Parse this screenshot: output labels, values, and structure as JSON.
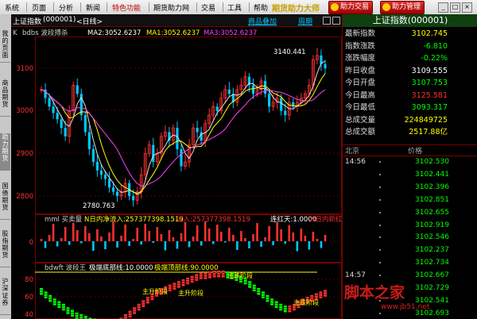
{
  "menu": {
    "items": [
      "系统",
      "页面",
      "分析",
      "新闻",
      "特色功能",
      "期货助力网",
      "交易",
      "工具",
      "帮助"
    ],
    "brand": "期货助力大师",
    "trade_btn": "助力交易",
    "manage_btn": "助力管理"
  },
  "left_tabs": [
    {
      "label": "我的页面",
      "active": false
    },
    {
      "label": "商品期货",
      "active": false
    },
    {
      "label": "助力期货",
      "active": true
    },
    {
      "label": "国债期货",
      "active": false
    },
    {
      "label": "股指期货",
      "active": false
    },
    {
      "label": "沪深证券",
      "active": false
    }
  ],
  "title_bar": {
    "name": "上证指数",
    "code": "(000001)",
    "period": "<日线>",
    "overlay_btn": "商品叠加",
    "cycle_btn": "周期"
  },
  "main_chart": {
    "indicator": "K",
    "name": "bdbs 波段搏杀",
    "ma2": "MA2:3052.6237",
    "ma1": "MA1:3052.6237",
    "ma3": "MA3:3052.6237",
    "y_ticks": [
      "3100",
      "3000",
      "2900",
      "2800"
    ],
    "high_label": "3140.441",
    "low_label": "2780.763"
  },
  "volume_chart": {
    "name": "mml 买卖量",
    "inflow_label": "N日内净流入:257377398.1519",
    "flow_label": "流入:257377398.1519",
    "streak_label": "连红天:1.0000",
    "red_label": "N日内新红天:",
    "y_ticks": [
      "0"
    ]
  },
  "osc_chart": {
    "name": "bdwft 波段王",
    "low_label": "极端底部线:10.0000",
    "high_label": "极端顶部线:90.0000",
    "y_ticks": [
      "80",
      "60",
      "40"
    ],
    "notes": [
      "主升阶段",
      "主升阶段",
      "主跌阶段",
      "主跌阶段"
    ]
  },
  "quote": {
    "title": "上证指数(000001)",
    "rows": [
      {
        "label": "最新指数",
        "value": "3102.745",
        "color": "yellow"
      },
      {
        "label": "指数涨跌",
        "value": "-6.810",
        "color": "green"
      },
      {
        "label": "涨跌幅度",
        "value": "-0.22%",
        "color": "green"
      },
      {
        "label": "昨日收盘",
        "value": "3109.555",
        "color": "white"
      },
      {
        "label": "今日开盘",
        "value": "3107.753",
        "color": "green"
      },
      {
        "label": "今日最高",
        "value": "3125.581",
        "color": "red"
      },
      {
        "label": "今日最低",
        "value": "3093.317",
        "color": "green"
      },
      {
        "label": "总成交量",
        "value": "224849725",
        "color": "yellow"
      },
      {
        "label": "总成交额",
        "value": "2517.88亿",
        "color": "yellow"
      }
    ],
    "tick_header_left": "北京",
    "tick_header_right": "价格"
  },
  "ticks": [
    {
      "time": "14:56",
      "price": "3102.530"
    },
    {
      "time": "",
      "price": "3102.441"
    },
    {
      "time": "",
      "price": "3102.396"
    },
    {
      "time": "",
      "price": "3102.851"
    },
    {
      "time": "",
      "price": "3102.655"
    },
    {
      "time": "",
      "price": "3102.919"
    },
    {
      "time": "",
      "price": "3102.546"
    },
    {
      "time": "",
      "price": "3102.237"
    },
    {
      "time": "",
      "price": "3102.734"
    },
    {
      "time": "14:57",
      "price": "3102.667"
    },
    {
      "time": "",
      "price": "3102.729"
    },
    {
      "time": "",
      "price": "3102.541"
    },
    {
      "time": "",
      "price": "3102.693"
    }
  ],
  "watermark": {
    "main": "脚本之家",
    "url": "www.jb51.net"
  }
}
